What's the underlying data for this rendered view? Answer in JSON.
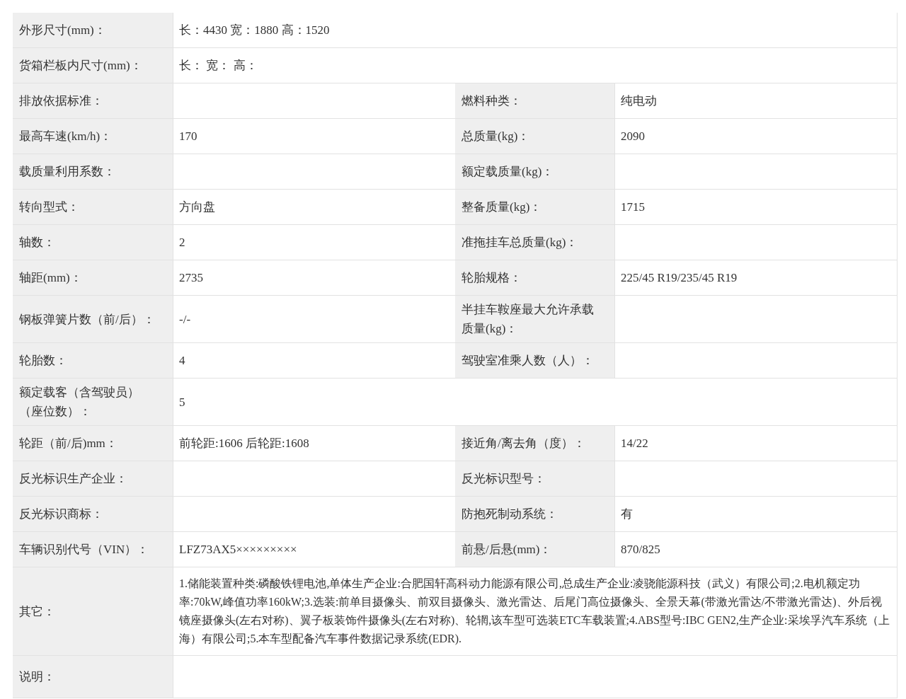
{
  "rows": [
    {
      "cells": [
        {
          "label": "外形尺寸(mm)：",
          "value": "长：4430 宽：1880 高：1520"
        }
      ]
    },
    {
      "cells": [
        {
          "label": "货箱栏板内尺寸(mm)：",
          "value": "长：  宽：  高："
        }
      ]
    },
    {
      "cells": [
        {
          "label": "排放依据标准："
        },
        {
          "label": "燃料种类：",
          "value": "纯电动"
        }
      ]
    },
    {
      "cells": [
        {
          "label": "最高车速(km/h)：",
          "value": "170"
        },
        {
          "label": "总质量(kg)：",
          "value": "2090"
        }
      ]
    },
    {
      "cells": [
        {
          "label": "载质量利用系数："
        },
        {
          "label": "额定载质量(kg)："
        }
      ]
    },
    {
      "cells": [
        {
          "label": "转向型式：",
          "value": "方向盘"
        },
        {
          "label": "整备质量(kg)：",
          "value": "1715"
        }
      ]
    },
    {
      "cells": [
        {
          "label": "轴数：",
          "value": "2"
        },
        {
          "label": "准拖挂车总质量(kg)："
        }
      ]
    },
    {
      "cells": [
        {
          "label": "轴距(mm)：",
          "value": "2735"
        },
        {
          "label": "轮胎规格：",
          "value": "225/45 R19/235/45 R19"
        }
      ]
    },
    {
      "cells": [
        {
          "label": "钢板弹簧片数（前/后）：",
          "value": "-/-"
        },
        {
          "label": "半挂车鞍座最大允许承载质量(kg)："
        }
      ]
    },
    {
      "cells": [
        {
          "label": "轮胎数：",
          "value": "4"
        },
        {
          "label": "驾驶室准乘人数（人）："
        }
      ]
    },
    {
      "cells": [
        {
          "label": "额定载客（含驾驶员）（座位数）：",
          "value": "5"
        }
      ]
    },
    {
      "cells": [
        {
          "label": "轮距（前/后)mm：",
          "value": "前轮距:1606 后轮距:1608"
        },
        {
          "label": "接近角/离去角（度）：",
          "value": "14/22"
        }
      ]
    },
    {
      "cells": [
        {
          "label": "反光标识生产企业："
        },
        {
          "label": "反光标识型号："
        }
      ]
    },
    {
      "cells": [
        {
          "label": "反光标识商标："
        },
        {
          "label": "防抱死制动系统：",
          "value": "有"
        }
      ]
    },
    {
      "cells": [
        {
          "label": "车辆识别代号（VIN）：",
          "value": "LFZ73AX5×××××××××"
        },
        {
          "label": "前悬/后悬(mm)：",
          "value": "870/825"
        }
      ]
    },
    {
      "cells": [
        {
          "label": "其它：",
          "value": "1.储能装置种类:磷酸铁锂电池,单体生产企业:合肥国轩高科动力能源有限公司,总成生产企业:凌骁能源科技（武义）有限公司;2.电机额定功率:70kW,峰值功率160kW;3.选装:前单目摄像头、前双目摄像头、激光雷达、后尾门高位摄像头、全景天幕(带激光雷达/不带激光雷达)、外后视镜座摄像头(左右对称)、翼子板装饰件摄像头(左右对称)、轮辋,该车型可选装ETC车载装置;4.ABS型号:IBC GEN2,生产企业:采埃孚汽车系统（上海）有限公司;5.本车型配备汽车事件数据记录系统(EDR)."
        }
      ]
    },
    {
      "cells": [
        {
          "label": "说明："
        }
      ]
    }
  ]
}
